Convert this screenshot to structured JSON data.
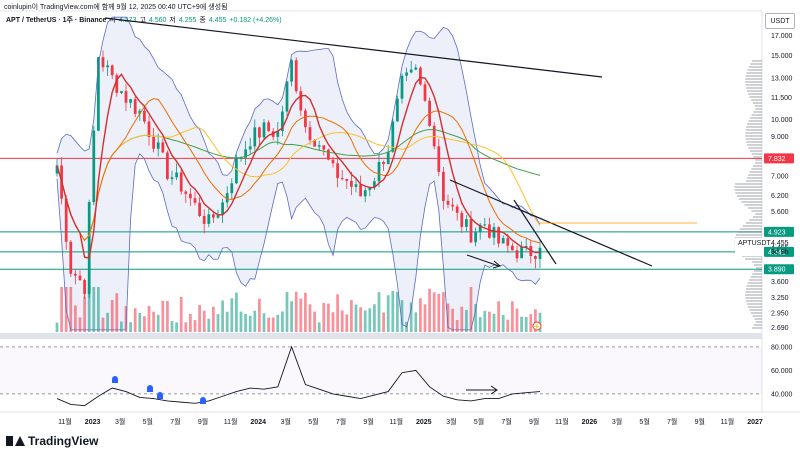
{
  "header": {
    "caption": "coinlupin이 TradingView.com에 함께 9월 12, 2025 00:40 UTC+9에 생성됨"
  },
  "legend": {
    "symbol": "APT / TetherUS · 1주 · Binance",
    "open_label": "시",
    "open_value": "4.273",
    "high_label": "고",
    "high_value": "4.560",
    "low_label": "저",
    "low_value": "4.255",
    "close_label": "종",
    "close_value": "4.455",
    "change": "+0.182 (+4.26%)"
  },
  "price_axis": {
    "currency": "USDT",
    "ticks": [
      "17.000",
      "15.000",
      "13.000",
      "11.500",
      "10.000",
      "9.000",
      "7.000",
      "6.200",
      "5.600",
      "4.455",
      "3.600",
      "3.250",
      "2.950",
      "2.690"
    ],
    "badges": [
      {
        "label": "7.832",
        "color": "#f23645"
      },
      {
        "label": "4.923",
        "color": "#089981"
      },
      {
        "label": "4.341",
        "color": "#089981"
      },
      {
        "label": "3.890",
        "color": "#089981"
      }
    ],
    "last_price_symbol": "APTUSDT",
    "last_price_value": "4.455",
    "countdown": "3d 9h"
  },
  "indicator_axis": {
    "ticks": [
      "80.000",
      "60.000",
      "40.000"
    ]
  },
  "time_axis": {
    "ticks": [
      "11월",
      "2023",
      "3월",
      "5월",
      "7월",
      "9월",
      "11월",
      "2024",
      "3월",
      "5월",
      "7월",
      "9월",
      "11월",
      "2025",
      "3월",
      "5월",
      "7월",
      "9월",
      "11월",
      "2026",
      "3월",
      "5월",
      "7월",
      "9월",
      "11월",
      "2027"
    ]
  },
  "footer": {
    "brand": "TradingView"
  },
  "colors": {
    "up": "#089981",
    "down": "#f23645",
    "bollinger": "#5b6bc0",
    "ma_fast": "#d32f2f",
    "ma_mid": "#ef6c00",
    "ma_slow": "#fbc02d",
    "ma_long": "#43a047"
  },
  "chart_data": {
    "type": "candlestick",
    "title": "APT / TetherUS · 1주 · Binance",
    "y_scale": "log",
    "ylim": [
      2.6,
      19.5
    ],
    "x": [
      "2022-10",
      "2022-11",
      "2022-12",
      "2023-01",
      "2023-02",
      "2023-03",
      "2023-04",
      "2023-05",
      "2023-06",
      "2023-07",
      "2023-08",
      "2023-09",
      "2023-10",
      "2023-11",
      "2023-12",
      "2024-01",
      "2024-02",
      "2024-03",
      "2024-04",
      "2024-05",
      "2024-06",
      "2024-07",
      "2024-08",
      "2024-09",
      "2024-10",
      "2024-11",
      "2024-12",
      "2025-01",
      "2025-02",
      "2025-03",
      "2025-04",
      "2025-05",
      "2025-06",
      "2025-07",
      "2025-08",
      "2025-09"
    ],
    "close": [
      7.5,
      3.9,
      3.5,
      15.0,
      13.0,
      11.5,
      10.5,
      8.8,
      7.2,
      6.6,
      5.8,
      5.2,
      5.9,
      7.6,
      8.9,
      9.4,
      9.2,
      14.3,
      9.6,
      8.6,
      7.2,
      6.8,
      6.2,
      7.0,
      8.4,
      12.5,
      13.5,
      10.2,
      6.2,
      5.4,
      4.9,
      5.2,
      4.6,
      4.4,
      4.3,
      4.455
    ],
    "horizontal_levels": [
      {
        "price": 7.832,
        "color": "#f23645"
      },
      {
        "price": 4.923,
        "color": "#089981"
      },
      {
        "price": 4.341,
        "color": "#089981"
      },
      {
        "price": 3.89,
        "color": "#089981"
      }
    ],
    "oscillator": {
      "ylim": [
        28,
        85
      ],
      "ticks": [
        80,
        60,
        40
      ],
      "values": [
        36,
        31,
        30,
        38,
        45,
        42,
        37,
        36,
        34,
        33,
        32,
        34,
        38,
        42,
        45,
        44,
        46,
        80,
        48,
        44,
        40,
        38,
        36,
        39,
        42,
        58,
        60,
        46,
        38,
        35,
        34,
        36,
        36,
        40,
        41,
        42
      ]
    }
  }
}
